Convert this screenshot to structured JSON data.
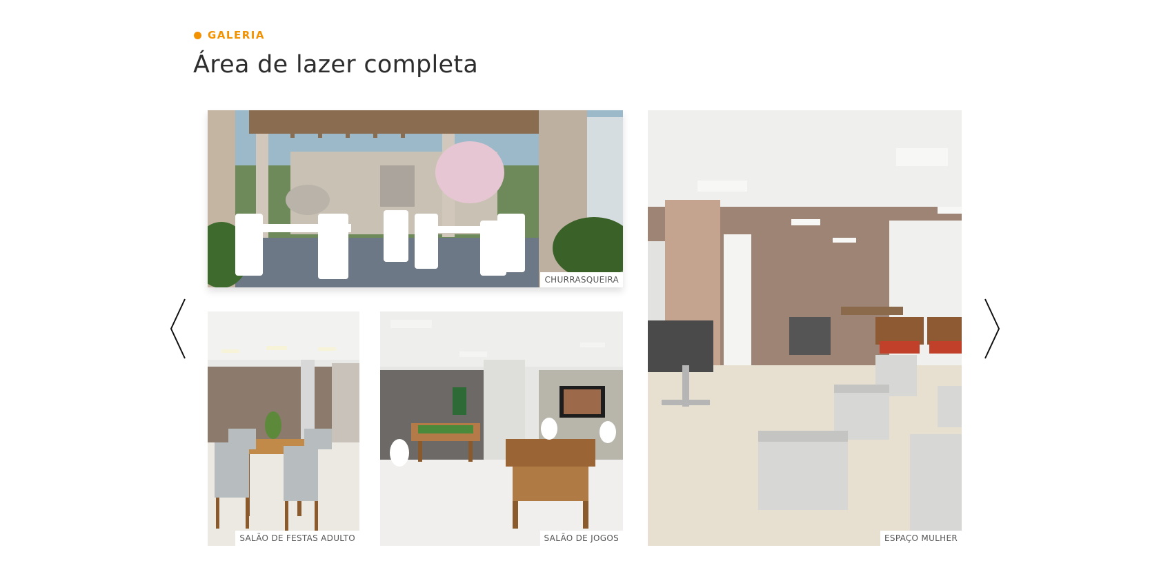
{
  "section": {
    "tag": "GALERIA",
    "title": "Área de lazer completa",
    "accent_color": "#f39200"
  },
  "navigation": {
    "prev_icon": "chevron-left-icon",
    "next_icon": "chevron-right-icon"
  },
  "gallery": {
    "items": [
      {
        "caption": "CHURRASQUEIRA"
      },
      {
        "caption": "SALÃO DE FESTAS ADULTO"
      },
      {
        "caption": "SALÃO DE JOGOS"
      },
      {
        "caption": "ESPAÇO MULHER"
      }
    ]
  }
}
